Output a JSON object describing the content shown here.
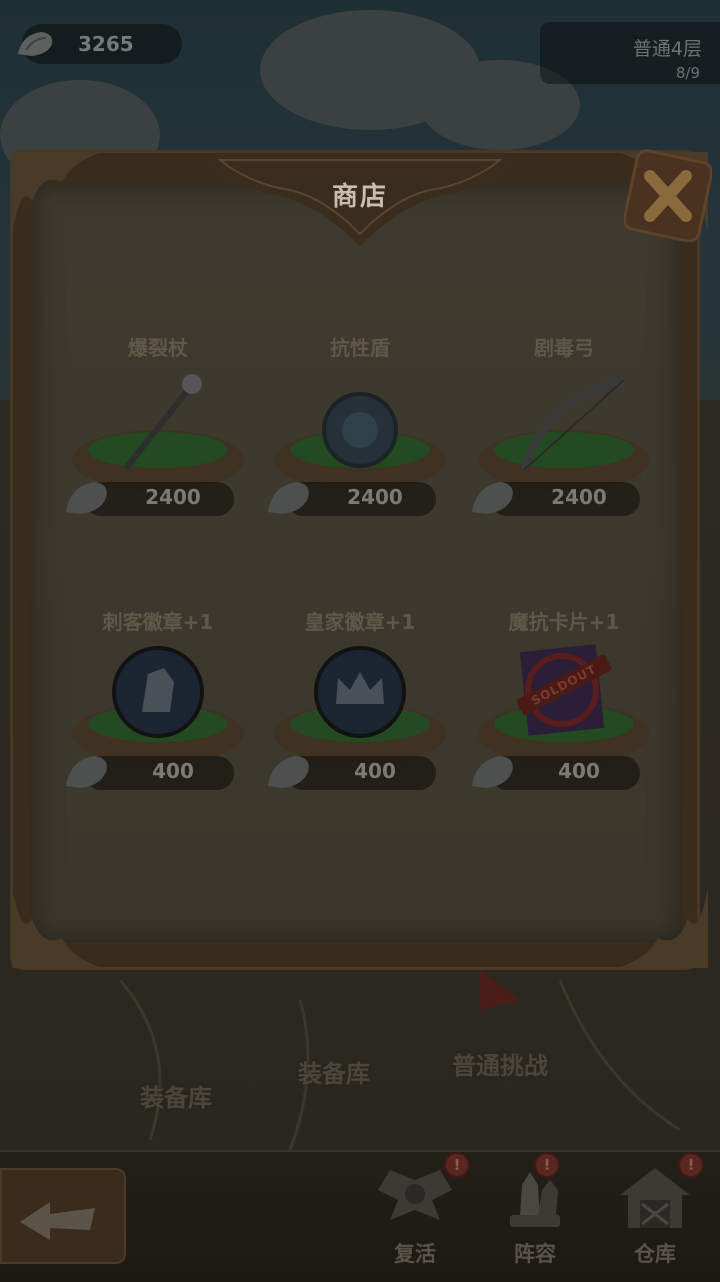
{
  "hud": {
    "currency_icon": "conch-shell-icon",
    "currency_value": "3265",
    "level_name": "普通4层",
    "level_progress": "8/9"
  },
  "shop": {
    "title": "商店",
    "close_icon": "close-x-icon",
    "items": [
      {
        "name": "爆裂杖",
        "icon": "staff-icon",
        "price": "2400",
        "sold_out": false
      },
      {
        "name": "抗性盾",
        "icon": "shield-icon",
        "price": "2400",
        "sold_out": false
      },
      {
        "name": "剧毒弓",
        "icon": "bow-icon",
        "price": "2400",
        "sold_out": false
      },
      {
        "name": "刺客徽章+1",
        "icon": "assassin-badge-icon",
        "price": "400",
        "sold_out": false
      },
      {
        "name": "皇家徽章+1",
        "icon": "royal-badge-icon",
        "price": "400",
        "sold_out": false
      },
      {
        "name": "魔抗卡片+1",
        "icon": "magic-resist-card-icon",
        "price": "400",
        "sold_out": true,
        "sold_out_stamp": "SOLDOUT"
      }
    ]
  },
  "background": {
    "labels": [
      "装备库",
      "装备库",
      "普通挑战"
    ]
  },
  "bottom_nav": {
    "items": [
      {
        "label": "复活",
        "icon": "wings-icon",
        "alert": "!"
      },
      {
        "label": "阵容",
        "icon": "chess-icon",
        "alert": "!"
      },
      {
        "label": "仓库",
        "icon": "warehouse-icon",
        "alert": "!"
      }
    ]
  }
}
